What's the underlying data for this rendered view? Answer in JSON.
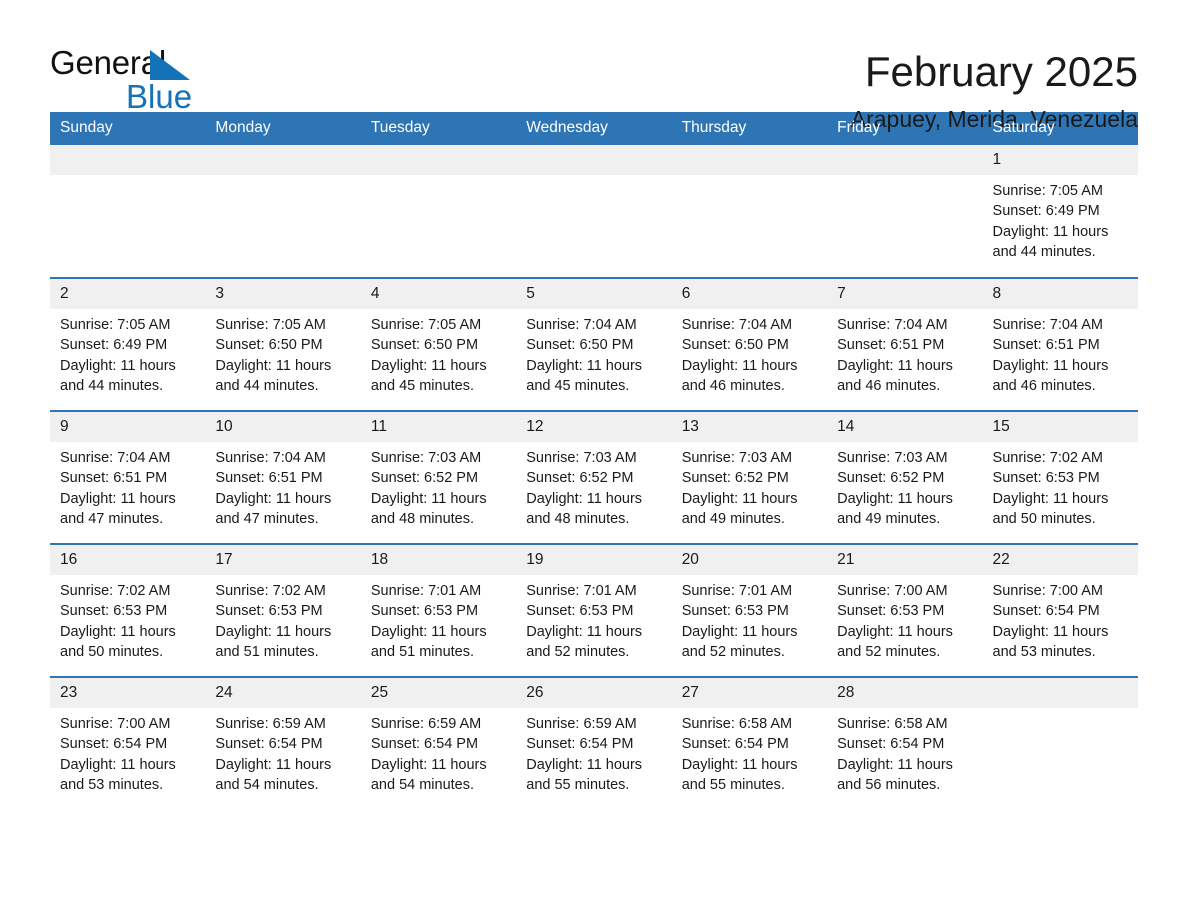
{
  "brand": {
    "name_part1": "General",
    "name_part2": "Blue",
    "accent_color": "#1473b8"
  },
  "header": {
    "title": "February 2025",
    "location": "Arapuey, Merida, Venezuela"
  },
  "theme": {
    "header_blue": "#2e75b6",
    "daynum_band": "#f0f0f0",
    "text": "#1a1a1a"
  },
  "weekdays": [
    "Sunday",
    "Monday",
    "Tuesday",
    "Wednesday",
    "Thursday",
    "Friday",
    "Saturday"
  ],
  "labels": {
    "sunrise_prefix": "Sunrise: ",
    "sunset_prefix": "Sunset: ",
    "daylight_prefix": "Daylight: "
  },
  "weeks": [
    [
      {
        "empty": true,
        "day": ""
      },
      {
        "empty": true,
        "day": ""
      },
      {
        "empty": true,
        "day": ""
      },
      {
        "empty": true,
        "day": ""
      },
      {
        "empty": true,
        "day": ""
      },
      {
        "empty": true,
        "day": ""
      },
      {
        "empty": false,
        "day": "1",
        "sunrise": "Sunrise: 7:05 AM",
        "sunset": "Sunset: 6:49 PM",
        "daylight": "Daylight: 11 hours and 44 minutes."
      }
    ],
    [
      {
        "empty": false,
        "day": "2",
        "sunrise": "Sunrise: 7:05 AM",
        "sunset": "Sunset: 6:49 PM",
        "daylight": "Daylight: 11 hours and 44 minutes."
      },
      {
        "empty": false,
        "day": "3",
        "sunrise": "Sunrise: 7:05 AM",
        "sunset": "Sunset: 6:50 PM",
        "daylight": "Daylight: 11 hours and 44 minutes."
      },
      {
        "empty": false,
        "day": "4",
        "sunrise": "Sunrise: 7:05 AM",
        "sunset": "Sunset: 6:50 PM",
        "daylight": "Daylight: 11 hours and 45 minutes."
      },
      {
        "empty": false,
        "day": "5",
        "sunrise": "Sunrise: 7:04 AM",
        "sunset": "Sunset: 6:50 PM",
        "daylight": "Daylight: 11 hours and 45 minutes."
      },
      {
        "empty": false,
        "day": "6",
        "sunrise": "Sunrise: 7:04 AM",
        "sunset": "Sunset: 6:50 PM",
        "daylight": "Daylight: 11 hours and 46 minutes."
      },
      {
        "empty": false,
        "day": "7",
        "sunrise": "Sunrise: 7:04 AM",
        "sunset": "Sunset: 6:51 PM",
        "daylight": "Daylight: 11 hours and 46 minutes."
      },
      {
        "empty": false,
        "day": "8",
        "sunrise": "Sunrise: 7:04 AM",
        "sunset": "Sunset: 6:51 PM",
        "daylight": "Daylight: 11 hours and 46 minutes."
      }
    ],
    [
      {
        "empty": false,
        "day": "9",
        "sunrise": "Sunrise: 7:04 AM",
        "sunset": "Sunset: 6:51 PM",
        "daylight": "Daylight: 11 hours and 47 minutes."
      },
      {
        "empty": false,
        "day": "10",
        "sunrise": "Sunrise: 7:04 AM",
        "sunset": "Sunset: 6:51 PM",
        "daylight": "Daylight: 11 hours and 47 minutes."
      },
      {
        "empty": false,
        "day": "11",
        "sunrise": "Sunrise: 7:03 AM",
        "sunset": "Sunset: 6:52 PM",
        "daylight": "Daylight: 11 hours and 48 minutes."
      },
      {
        "empty": false,
        "day": "12",
        "sunrise": "Sunrise: 7:03 AM",
        "sunset": "Sunset: 6:52 PM",
        "daylight": "Daylight: 11 hours and 48 minutes."
      },
      {
        "empty": false,
        "day": "13",
        "sunrise": "Sunrise: 7:03 AM",
        "sunset": "Sunset: 6:52 PM",
        "daylight": "Daylight: 11 hours and 49 minutes."
      },
      {
        "empty": false,
        "day": "14",
        "sunrise": "Sunrise: 7:03 AM",
        "sunset": "Sunset: 6:52 PM",
        "daylight": "Daylight: 11 hours and 49 minutes."
      },
      {
        "empty": false,
        "day": "15",
        "sunrise": "Sunrise: 7:02 AM",
        "sunset": "Sunset: 6:53 PM",
        "daylight": "Daylight: 11 hours and 50 minutes."
      }
    ],
    [
      {
        "empty": false,
        "day": "16",
        "sunrise": "Sunrise: 7:02 AM",
        "sunset": "Sunset: 6:53 PM",
        "daylight": "Daylight: 11 hours and 50 minutes."
      },
      {
        "empty": false,
        "day": "17",
        "sunrise": "Sunrise: 7:02 AM",
        "sunset": "Sunset: 6:53 PM",
        "daylight": "Daylight: 11 hours and 51 minutes."
      },
      {
        "empty": false,
        "day": "18",
        "sunrise": "Sunrise: 7:01 AM",
        "sunset": "Sunset: 6:53 PM",
        "daylight": "Daylight: 11 hours and 51 minutes."
      },
      {
        "empty": false,
        "day": "19",
        "sunrise": "Sunrise: 7:01 AM",
        "sunset": "Sunset: 6:53 PM",
        "daylight": "Daylight: 11 hours and 52 minutes."
      },
      {
        "empty": false,
        "day": "20",
        "sunrise": "Sunrise: 7:01 AM",
        "sunset": "Sunset: 6:53 PM",
        "daylight": "Daylight: 11 hours and 52 minutes."
      },
      {
        "empty": false,
        "day": "21",
        "sunrise": "Sunrise: 7:00 AM",
        "sunset": "Sunset: 6:53 PM",
        "daylight": "Daylight: 11 hours and 52 minutes."
      },
      {
        "empty": false,
        "day": "22",
        "sunrise": "Sunrise: 7:00 AM",
        "sunset": "Sunset: 6:54 PM",
        "daylight": "Daylight: 11 hours and 53 minutes."
      }
    ],
    [
      {
        "empty": false,
        "day": "23",
        "sunrise": "Sunrise: 7:00 AM",
        "sunset": "Sunset: 6:54 PM",
        "daylight": "Daylight: 11 hours and 53 minutes."
      },
      {
        "empty": false,
        "day": "24",
        "sunrise": "Sunrise: 6:59 AM",
        "sunset": "Sunset: 6:54 PM",
        "daylight": "Daylight: 11 hours and 54 minutes."
      },
      {
        "empty": false,
        "day": "25",
        "sunrise": "Sunrise: 6:59 AM",
        "sunset": "Sunset: 6:54 PM",
        "daylight": "Daylight: 11 hours and 54 minutes."
      },
      {
        "empty": false,
        "day": "26",
        "sunrise": "Sunrise: 6:59 AM",
        "sunset": "Sunset: 6:54 PM",
        "daylight": "Daylight: 11 hours and 55 minutes."
      },
      {
        "empty": false,
        "day": "27",
        "sunrise": "Sunrise: 6:58 AM",
        "sunset": "Sunset: 6:54 PM",
        "daylight": "Daylight: 11 hours and 55 minutes."
      },
      {
        "empty": false,
        "day": "28",
        "sunrise": "Sunrise: 6:58 AM",
        "sunset": "Sunset: 6:54 PM",
        "daylight": "Daylight: 11 hours and 56 minutes."
      },
      {
        "empty": true,
        "day": ""
      }
    ]
  ]
}
